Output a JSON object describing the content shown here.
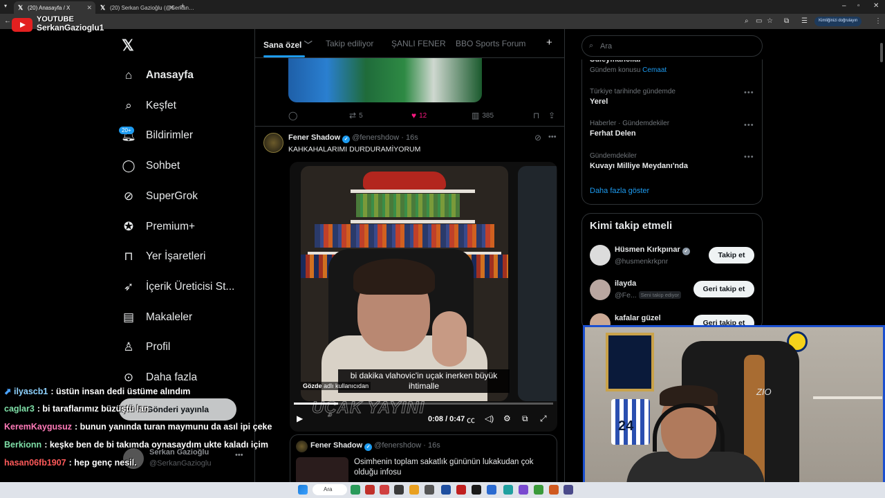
{
  "browser": {
    "tabs": [
      {
        "label": "(20) Anasayfa / X"
      },
      {
        "label": "(20) Serkan Gazioğlu (@Serkan…"
      }
    ],
    "new_tab": "+",
    "verify_label": "Kimliğinizi doğrulayın"
  },
  "stream": {
    "platform": "YOUTUBE",
    "channel": "SerkanGazioglu1"
  },
  "nav": {
    "items": [
      {
        "label": "Anasayfa",
        "icon": "home-icon"
      },
      {
        "label": "Keşfet",
        "icon": "search-icon"
      },
      {
        "label": "Bildirimler",
        "icon": "bell-icon"
      },
      {
        "label": "Sohbet",
        "icon": "chat-icon"
      },
      {
        "label": "SuperGrok",
        "icon": "grok-icon"
      },
      {
        "label": "Premium+",
        "icon": "premium-icon"
      },
      {
        "label": "Yer İşaretleri",
        "icon": "bookmark-icon"
      },
      {
        "label": "İçerik Üreticisi St...",
        "icon": "rocket-icon"
      },
      {
        "label": "Makaleler",
        "icon": "article-icon"
      },
      {
        "label": "Profil",
        "icon": "profile-icon"
      },
      {
        "label": "Daha fazla",
        "icon": "more-icon"
      }
    ],
    "notif_badge": "20+",
    "post_button": "Gönderi yayınla",
    "profile_name": "Serkan Gazioğlu",
    "profile_handle": "@SerkanGazioglu"
  },
  "feed": {
    "tabs": [
      "Sana özel",
      "Takip ediliyor",
      "ŞANLI FENER",
      "BBO Sports Forum"
    ],
    "add_tab": "+",
    "prev_post": {
      "retweets": "5",
      "likes": "12",
      "views": "385"
    },
    "post": {
      "name": "Fener Shadow",
      "handle": "@fenershdow",
      "time": "16s",
      "text": "KAHKAHALARIMI DURDURAMİYORUM",
      "subtitle_line1": "bi dakika vlahovic'in uçak inerken büyük",
      "subtitle_line2": "ihtimalle",
      "source_label": "Gözde",
      "source_suffix": "adlı kullanıcıdan",
      "overlay_text": "UÇAK YAYINI",
      "video_time": "0:08 / 0:47",
      "progress": 0.17
    },
    "quoted": {
      "name": "Fener Shadow",
      "handle": "@fenershdow",
      "time": "16s",
      "text_line1": "Osimhenin toplam sakatlık gününün lukakudan çok",
      "text_line2": "olduğu infosu"
    }
  },
  "sidebar": {
    "search_placeholder": "Ara",
    "trends": [
      {
        "meta": "",
        "name": "Süleymancılar",
        "meta2_prefix": "Gündem konusu",
        "meta2_link": "Cemaat"
      },
      {
        "meta": "Türkiye tarihinde gündemde",
        "name": "Yerel"
      },
      {
        "meta": "Haberler · Gündemdekiler",
        "name": "Ferhat Delen"
      },
      {
        "meta": "Gündemdekiler",
        "name": "Kuvayı Milliye Meydanı'nda"
      }
    ],
    "show_more": "Daha fazla göster",
    "who_to_follow_title": "Kimi takip etmeli",
    "who": [
      {
        "name": "Hüsmen Kırkpınar",
        "handle": "@husmenkrkpnr",
        "button": "Takip et"
      },
      {
        "name": "ilayda",
        "handle": "@Fe...",
        "follows_you": "Seni takip ediyor",
        "button": "Geri takip et"
      },
      {
        "name": "kafalar güzel",
        "button": "Geri takip et"
      }
    ]
  },
  "chat": [
    {
      "user": "ilyascb1",
      "color": "#8fd3ff",
      "message": ": üstün insan dedi üstüme alındım"
    },
    {
      "user": "caglar3",
      "color": "#7fe0a8",
      "message": ": bi taraflarımız büzüştü lan"
    },
    {
      "user": "KeremKaygusuz",
      "color": "#ff7ab8",
      "message": ": bunun yanında turan maymunu da asıl ipi çeke"
    },
    {
      "user": "Berkionn",
      "color": "#7fe0a8",
      "message": ": keşke ben de bi takımda oynasaydım ukte kaladı içim"
    },
    {
      "user": "hasan06fb1907",
      "color": "#ff5a5a",
      "message": ": hep genç nesil."
    }
  ],
  "webcam": {
    "jersey_number": "24",
    "chair_brand": "ZIO"
  },
  "taskbar": {
    "search_label": "Ara"
  }
}
